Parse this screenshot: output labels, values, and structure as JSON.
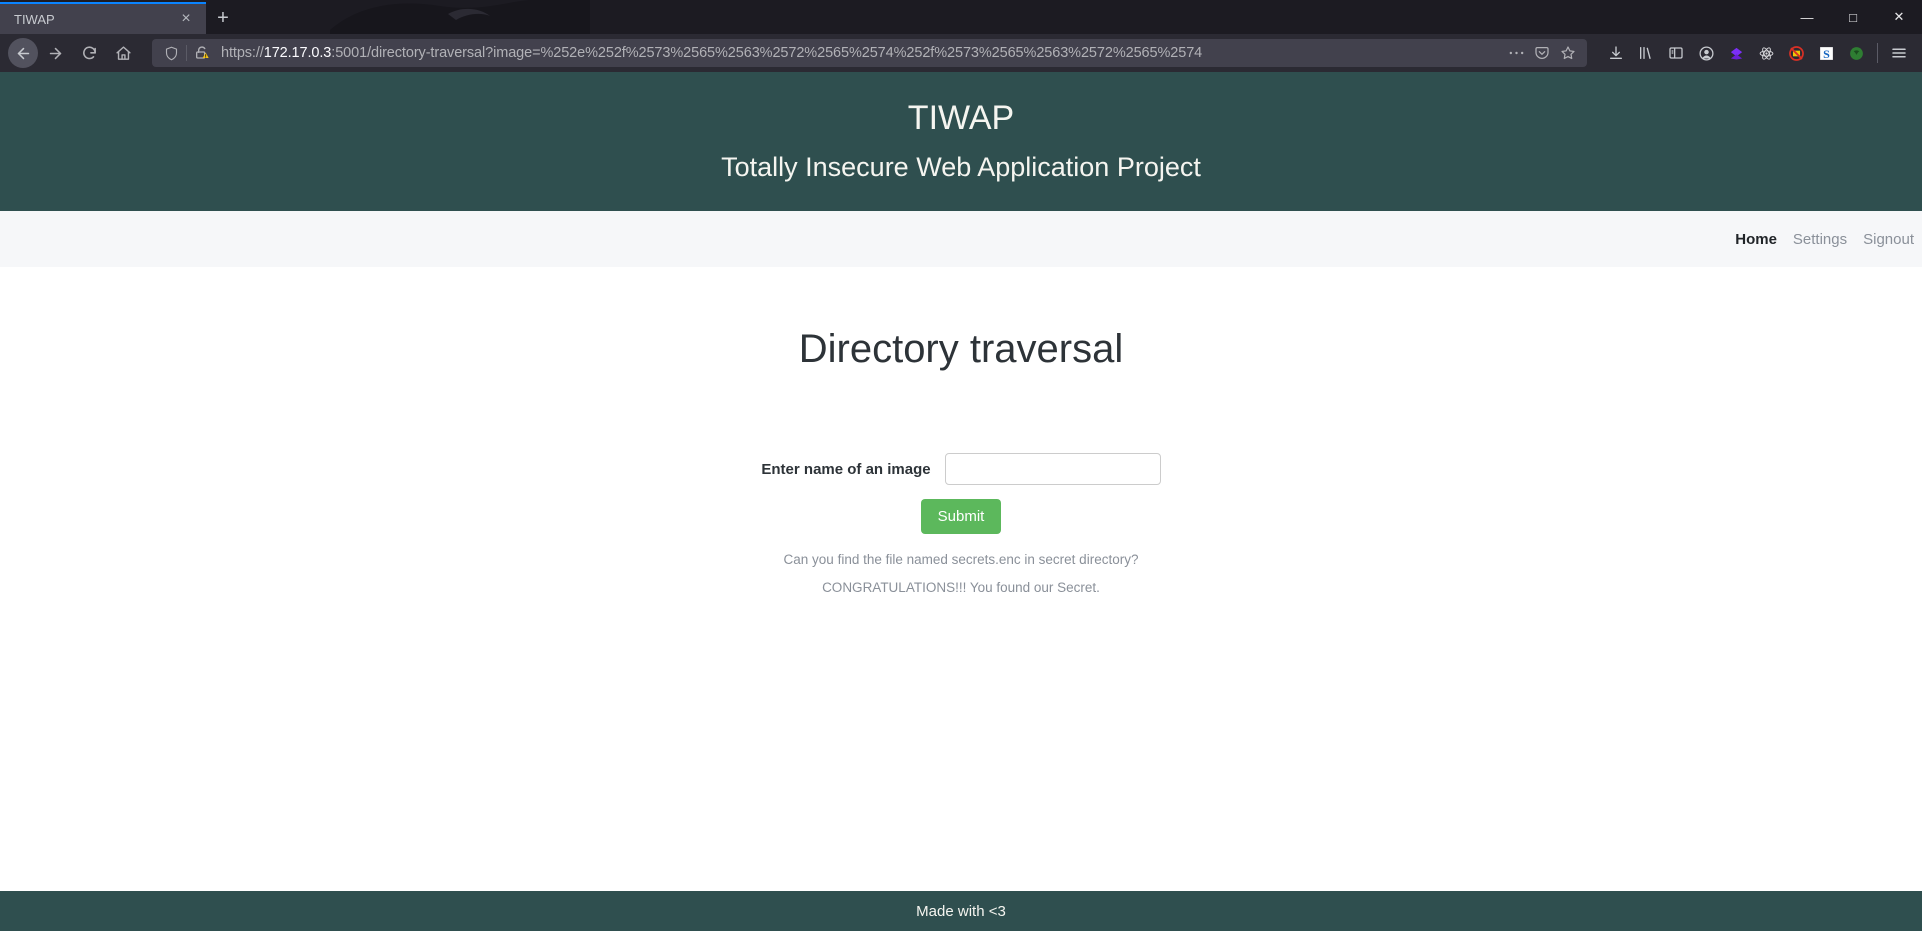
{
  "browser": {
    "tab": {
      "title": "TIWAP",
      "close_label": "×"
    },
    "new_tab_label": "+",
    "window_controls": {
      "minimize": "—",
      "maximize": "□",
      "close": "✕"
    },
    "nav_buttons": {
      "back": "back-arrow",
      "forward": "forward-arrow",
      "reload": "reload",
      "home": "home"
    },
    "url": {
      "scheme": "https://",
      "host": "172.17.0.3",
      "rest": ":5001/directory-traversal?image=%252e%252f%2573%2565%2563%2572%2565%2574%252f%2573%2565%2563%2572%2565%2574",
      "full": "https://172.17.0.3:5001/directory-traversal?image=%252e%252f%2573%2565%2563%2572%2565%2574%252f%2573%2565%2563%2572%2565%2574",
      "tracking_protection_icon": "shield-icon",
      "connection_icon": "insecure-lock-warning-icon",
      "page_actions_icon": "ellipsis-icon",
      "pocket_icon": "pocket-icon",
      "bookmark_icon": "star-icon"
    },
    "toolbar_icons": [
      {
        "name": "downloads-icon",
        "glyph": "download"
      },
      {
        "name": "library-icon",
        "glyph": "library"
      },
      {
        "name": "sidebar-icon",
        "glyph": "sidebar"
      },
      {
        "name": "account-icon",
        "glyph": "account"
      },
      {
        "name": "extension-diamond-icon",
        "glyph": "diamond",
        "color": "#7b2ff7"
      },
      {
        "name": "extension-react-icon",
        "glyph": "atom",
        "color": "#d7d7db"
      },
      {
        "name": "extension-noscript-icon",
        "glyph": "noscript",
        "color": "#d93025"
      },
      {
        "name": "extension-s-icon",
        "glyph": "letter-s",
        "color": "#1565c0"
      },
      {
        "name": "extension-green-icon",
        "glyph": "green-blob",
        "color": "#2e7d32"
      },
      {
        "name": "app-menu-icon",
        "glyph": "hamburger"
      }
    ]
  },
  "page": {
    "header": {
      "title": "TIWAP",
      "subtitle": "Totally Insecure Web Application Project",
      "background": "#2f4f4f"
    },
    "nav": {
      "links": [
        {
          "label": "Home",
          "active": true
        },
        {
          "label": "Settings",
          "active": false
        },
        {
          "label": "Signout",
          "active": false
        }
      ]
    },
    "main": {
      "title": "Directory traversal",
      "form": {
        "label": "Enter name of an image",
        "input_value": "",
        "input_placeholder": "",
        "submit_label": "Submit"
      },
      "hint": "Can you find the file named secrets.enc in secret directory?",
      "result": "CONGRATULATIONS!!! You found our Secret."
    },
    "footer": {
      "text": "Made with <3"
    },
    "colors": {
      "brand": "#2f4f4f",
      "navstrip": "#f6f7f9",
      "submit": "#5cb85c",
      "muted_text": "#8a9099"
    }
  }
}
